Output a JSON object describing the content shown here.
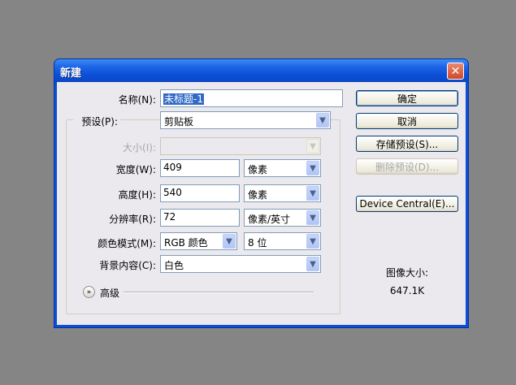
{
  "dialog": {
    "title": "新建",
    "close_glyph": "✕",
    "name": {
      "label": "名称(N):",
      "value": "未标题-1"
    },
    "preset": {
      "label": "预设(P):",
      "value": "剪贴板"
    },
    "size": {
      "label": "大小(I):",
      "value": ""
    },
    "width": {
      "label": "宽度(W):",
      "value": "409",
      "unit": "像素"
    },
    "height": {
      "label": "高度(H):",
      "value": "540",
      "unit": "像素"
    },
    "resolution": {
      "label": "分辨率(R):",
      "value": "72",
      "unit": "像素/英寸"
    },
    "color_mode": {
      "label": "颜色模式(M):",
      "mode": "RGB 颜色",
      "depth": "8 位"
    },
    "background": {
      "label": "背景内容(C):",
      "value": "白色"
    },
    "advanced": {
      "label": "高级"
    },
    "buttons": {
      "ok": "确定",
      "cancel": "取消",
      "save_preset": "存储预设(S)...",
      "delete_preset": "删除预设(D)...",
      "device_central": "Device Central(E)..."
    },
    "image_size": {
      "label": "图像大小:",
      "value": "647.1K"
    }
  },
  "colors": {
    "titlebar": "#0a4fd6",
    "client": "#ebe9ed",
    "desktop": "#858585"
  },
  "icons": {
    "close": "close-icon",
    "dropdown": "chevron-down-icon",
    "advanced": "expand-chevron-icon"
  }
}
